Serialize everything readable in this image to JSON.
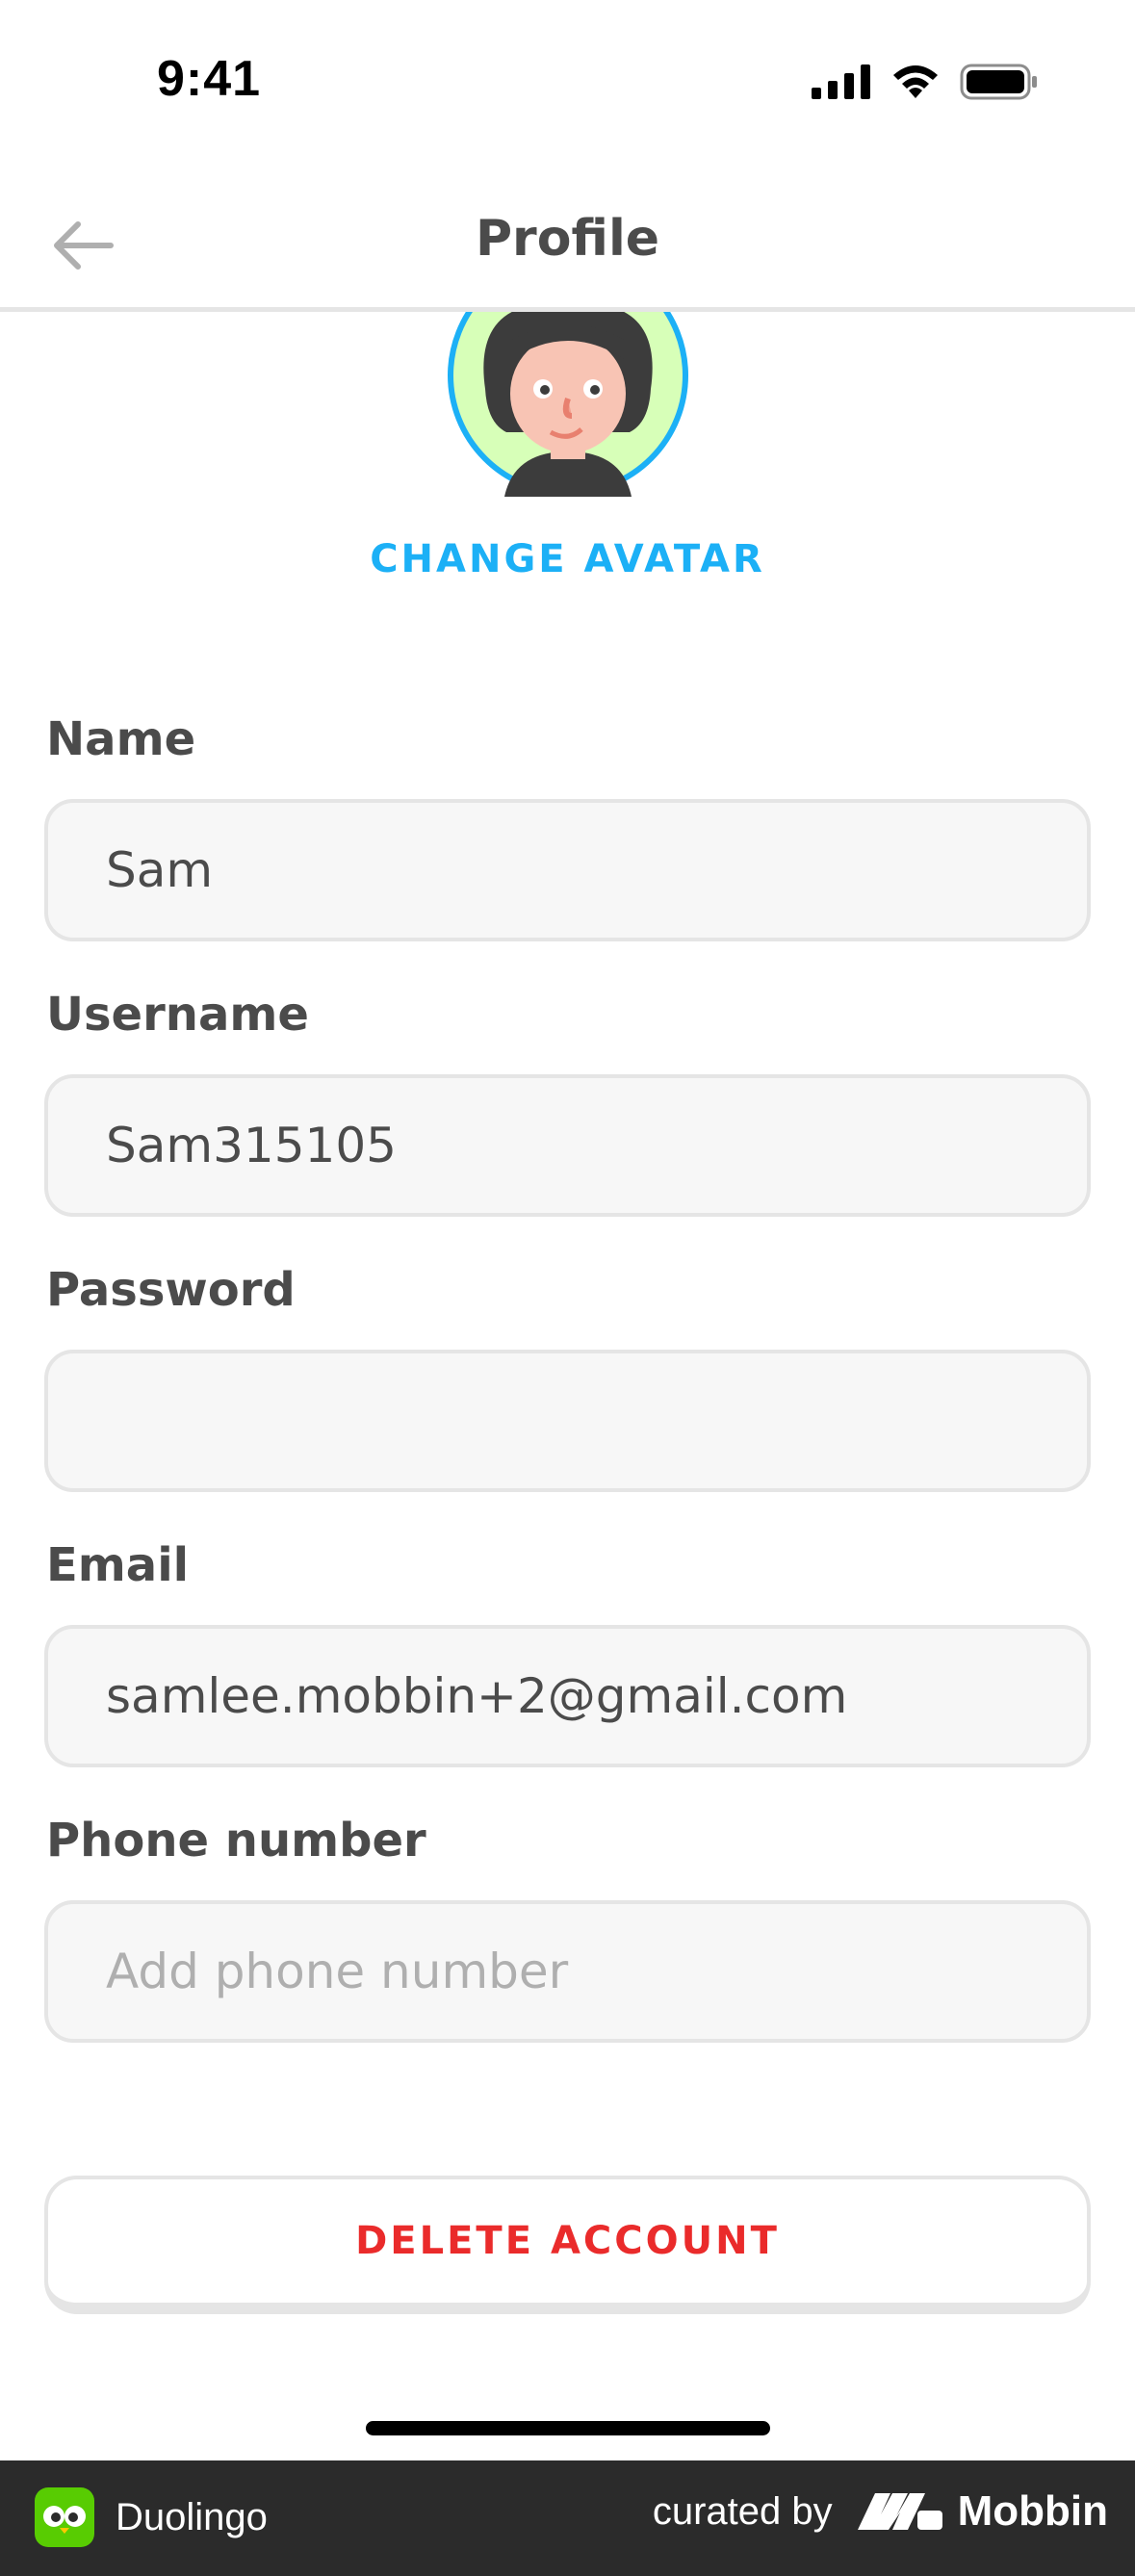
{
  "status_bar": {
    "time": "9:41"
  },
  "header": {
    "title": "Profile"
  },
  "avatar": {
    "change_label": "CHANGE AVATAR"
  },
  "form": {
    "name": {
      "label": "Name",
      "value": "Sam"
    },
    "username": {
      "label": "Username",
      "value": "Sam315105"
    },
    "password": {
      "label": "Password",
      "value": ""
    },
    "email": {
      "label": "Email",
      "value": "samlee.mobbin+2@gmail.com"
    },
    "phone": {
      "label": "Phone number",
      "placeholder": "Add phone number"
    }
  },
  "actions": {
    "delete_label": "DELETE ACCOUNT"
  },
  "footer": {
    "app_name": "Duolingo",
    "curated_by": "curated by",
    "brand": "Mobbin"
  },
  "colors": {
    "accent": "#1cb0f6",
    "danger": "#ea2b2b",
    "app_green": "#58cc02"
  },
  "icons": [
    "back-arrow-icon",
    "signal-icon",
    "wifi-icon",
    "battery-icon",
    "duolingo-logo-icon",
    "mobbin-logo-icon"
  ]
}
